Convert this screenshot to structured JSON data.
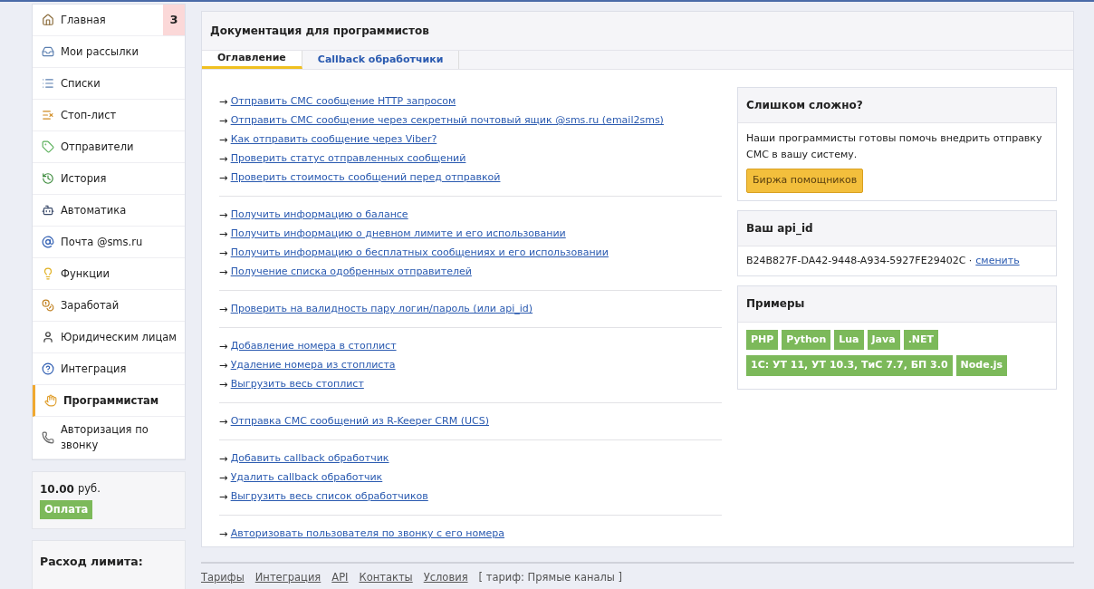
{
  "sidebar": {
    "items": [
      {
        "label": "Главная",
        "selected": false,
        "badge": "3"
      },
      {
        "label": "Мои рассылки",
        "selected": false
      },
      {
        "label": "Списки",
        "selected": false
      },
      {
        "label": "Стоп-лист",
        "selected": false
      },
      {
        "label": "Отправители",
        "selected": false
      },
      {
        "label": "История",
        "selected": false
      },
      {
        "label": "Автоматика",
        "selected": false
      },
      {
        "label": "Почта @sms.ru",
        "selected": false
      },
      {
        "label": "Функции",
        "selected": false
      },
      {
        "label": "Заработай",
        "selected": false
      },
      {
        "label": "Юридическим лицам",
        "selected": false
      },
      {
        "label": "Интеграция",
        "selected": false
      },
      {
        "label": "Программистам",
        "selected": true
      },
      {
        "label": "Авторизация по звонку",
        "selected": false
      }
    ],
    "balance": {
      "amount": "10.00",
      "currency": "руб.",
      "button": "Оплата"
    },
    "limit_title": "Расход лимита:"
  },
  "main": {
    "title": "Документация для программистов",
    "tabs": [
      {
        "label": "Оглавление",
        "selected": true
      },
      {
        "label": "Callback обработчики",
        "selected": false
      }
    ],
    "arrow": "→",
    "link_groups": [
      [
        "Отправить СМС сообщение HTTP запросом",
        "Отправить СМС сообщение через секретный почтовый ящик @sms.ru (email2sms)",
        "Как отправить сообщение через Viber?",
        "Проверить статус отправленных сообщений",
        "Проверить стоимость сообщений перед отправкой"
      ],
      [
        "Получить информацию о балансе",
        "Получить информацию о дневном лимите и его использовании",
        "Получить информацию о бесплатных сообщениях и его использовании",
        "Получение списка одобренных отправителей"
      ],
      [
        "Проверить на валидность пару логин/пароль (или api_id)"
      ],
      [
        "Добавление номера в стоплист",
        "Удаление номера из стоплиста",
        "Выгрузить весь стоплист"
      ],
      [
        "Отправка СМС сообщений из R-Keeper CRM (UCS)"
      ],
      [
        "Добавить callback обработчик",
        "Удалить callback обработчик",
        "Выгрузить весь список обработчиков"
      ],
      [
        "Авторизовать пользователя по звонку с его номера"
      ]
    ],
    "help": {
      "title": "Слишком сложно?",
      "text": "Наши программисты готовы помочь внедрить отправку СМС в вашу систему.",
      "button": "Биржа помощников"
    },
    "api": {
      "title": "Ваш api_id",
      "value": "B24B827F-DA42-9448-A934-5927FE29402C ·",
      "link": "сменить"
    },
    "examples": {
      "title": "Примеры",
      "tags": [
        "PHP",
        "Python",
        "Lua",
        "Java",
        ".NET",
        "1С: УТ 11, УТ 10.3, ТиС 7.7, БП 3.0",
        "Node.js"
      ]
    }
  },
  "footer": {
    "links": [
      "Тарифы",
      "Интеграция",
      "API",
      "Контакты",
      "Условия"
    ],
    "tariff": "[ тариф: Прямые каналы ]"
  }
}
